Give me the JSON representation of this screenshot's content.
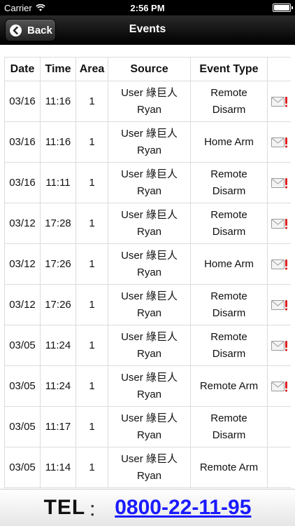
{
  "status_bar": {
    "carrier": "Carrier",
    "time": "2:56 PM",
    "wifi_icon": "wifi-icon",
    "battery_icon": "battery-icon"
  },
  "nav": {
    "back_label": "Back",
    "back_icon": "chevron-left-icon",
    "title": "Events"
  },
  "table": {
    "headers": [
      "Date",
      "Time",
      "Area",
      "Source",
      "Event Type",
      ""
    ],
    "rows": [
      {
        "date": "03/16",
        "time": "11:16",
        "area": "1",
        "source_line1": "User 綠巨人",
        "source_line2": "Ryan",
        "type_line1": "Remote",
        "type_line2": "Disarm",
        "mail": true
      },
      {
        "date": "03/16",
        "time": "11:16",
        "area": "1",
        "source_line1": "User 綠巨人",
        "source_line2": "Ryan",
        "type_line1": "Home Arm",
        "type_line2": "",
        "mail": true
      },
      {
        "date": "03/16",
        "time": "11:11",
        "area": "1",
        "source_line1": "User 綠巨人",
        "source_line2": "Ryan",
        "type_line1": "Remote",
        "type_line2": "Disarm",
        "mail": true
      },
      {
        "date": "03/12",
        "time": "17:28",
        "area": "1",
        "source_line1": "User 綠巨人",
        "source_line2": "Ryan",
        "type_line1": "Remote",
        "type_line2": "Disarm",
        "mail": true
      },
      {
        "date": "03/12",
        "time": "17:26",
        "area": "1",
        "source_line1": "User 綠巨人",
        "source_line2": "Ryan",
        "type_line1": "Home Arm",
        "type_line2": "",
        "mail": true
      },
      {
        "date": "03/12",
        "time": "17:26",
        "area": "1",
        "source_line1": "User 綠巨人",
        "source_line2": "Ryan",
        "type_line1": "Remote",
        "type_line2": "Disarm",
        "mail": true
      },
      {
        "date": "03/05",
        "time": "11:24",
        "area": "1",
        "source_line1": "User 綠巨人",
        "source_line2": "Ryan",
        "type_line1": "Remote",
        "type_line2": "Disarm",
        "mail": true
      },
      {
        "date": "03/05",
        "time": "11:24",
        "area": "1",
        "source_line1": "User 綠巨人",
        "source_line2": "Ryan",
        "type_line1": "Remote Arm",
        "type_line2": "",
        "mail": true
      },
      {
        "date": "03/05",
        "time": "11:17",
        "area": "1",
        "source_line1": "User 綠巨人",
        "source_line2": "Ryan",
        "type_line1": "Remote",
        "type_line2": "Disarm",
        "mail": false
      },
      {
        "date": "03/05",
        "time": "11:14",
        "area": "1",
        "source_line1": "User 綠巨人",
        "source_line2": "Ryan",
        "type_line1": "Remote Arm",
        "type_line2": "",
        "mail": false
      }
    ],
    "mail_icon": "envelope-alert-icon"
  },
  "footer": {
    "tel_label": "TEL",
    "tel_colon": "：",
    "tel_number": "0800-22-11-95"
  },
  "colors": {
    "nav_bg": "#1a1a1a",
    "link_blue": "#1a1aff",
    "alert_red": "#e02020"
  }
}
